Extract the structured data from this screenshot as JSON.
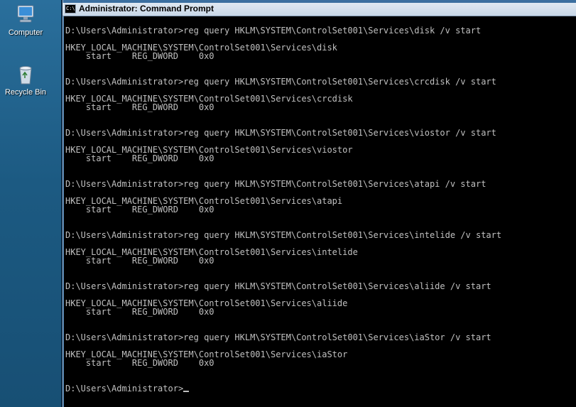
{
  "desktop": {
    "icons": [
      {
        "label": "Computer",
        "icon": "computer-icon"
      },
      {
        "label": "Recycle Bin",
        "icon": "recycle-bin-icon"
      }
    ]
  },
  "window": {
    "title": "Administrator: Command Prompt",
    "icon_text": "C:\\"
  },
  "console": {
    "lines": [
      "D:\\Users\\Administrator>reg query HKLM\\SYSTEM\\ControlSet001\\Services\\disk /v start",
      "",
      "HKEY_LOCAL_MACHINE\\SYSTEM\\ControlSet001\\Services\\disk",
      "    start    REG_DWORD    0x0",
      "",
      "",
      "D:\\Users\\Administrator>reg query HKLM\\SYSTEM\\ControlSet001\\Services\\crcdisk /v start",
      "",
      "HKEY_LOCAL_MACHINE\\SYSTEM\\ControlSet001\\Services\\crcdisk",
      "    start    REG_DWORD    0x0",
      "",
      "",
      "D:\\Users\\Administrator>reg query HKLM\\SYSTEM\\ControlSet001\\Services\\viostor /v start",
      "",
      "HKEY_LOCAL_MACHINE\\SYSTEM\\ControlSet001\\Services\\viostor",
      "    start    REG_DWORD    0x0",
      "",
      "",
      "D:\\Users\\Administrator>reg query HKLM\\SYSTEM\\ControlSet001\\Services\\atapi /v start",
      "",
      "HKEY_LOCAL_MACHINE\\SYSTEM\\ControlSet001\\Services\\atapi",
      "    start    REG_DWORD    0x0",
      "",
      "",
      "D:\\Users\\Administrator>reg query HKLM\\SYSTEM\\ControlSet001\\Services\\intelide /v start",
      "",
      "HKEY_LOCAL_MACHINE\\SYSTEM\\ControlSet001\\Services\\intelide",
      "    start    REG_DWORD    0x0",
      "",
      "",
      "D:\\Users\\Administrator>reg query HKLM\\SYSTEM\\ControlSet001\\Services\\aliide /v start",
      "",
      "HKEY_LOCAL_MACHINE\\SYSTEM\\ControlSet001\\Services\\aliide",
      "    start    REG_DWORD    0x0",
      "",
      "",
      "D:\\Users\\Administrator>reg query HKLM\\SYSTEM\\ControlSet001\\Services\\iaStor /v start",
      "",
      "HKEY_LOCAL_MACHINE\\SYSTEM\\ControlSet001\\Services\\iaStor",
      "    start    REG_DWORD    0x0",
      "",
      ""
    ],
    "prompt": "D:\\Users\\Administrator>"
  }
}
